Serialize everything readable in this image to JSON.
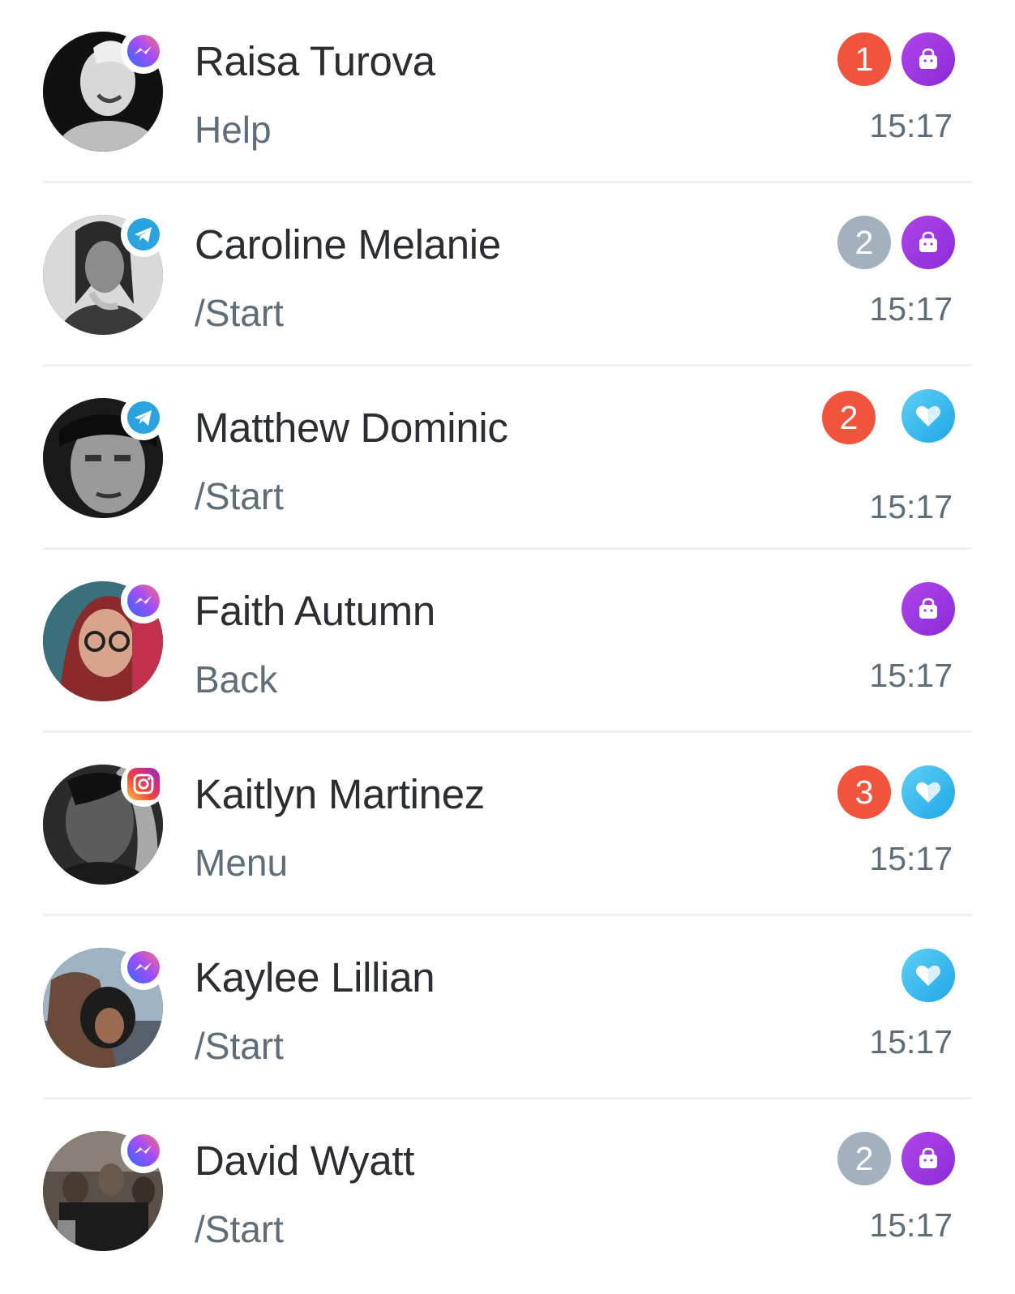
{
  "colors": {
    "unread_badge": "#f1543d",
    "read_badge": "#a2b1bd",
    "shop_tag": "#9b38e0",
    "heart_tag": "#3dbcef",
    "name_text": "#2a2d31",
    "secondary_text": "#5e6d78",
    "divider": "#eef1f3"
  },
  "chats": [
    {
      "name": "Raisa Turova",
      "preview": "Help",
      "time": "15:17",
      "channel_icon": "messenger-icon",
      "badge": "1",
      "badge_style": "unread",
      "tag_icon": "shopping-bag-icon"
    },
    {
      "name": "Caroline Melanie",
      "preview": "/Start",
      "time": "15:17",
      "channel_icon": "telegram-icon",
      "badge": "2",
      "badge_style": "read",
      "tag_icon": "shopping-bag-icon"
    },
    {
      "name": "Matthew Dominic",
      "preview": "/Start",
      "time": "15:17",
      "channel_icon": "telegram-icon",
      "badge": "2",
      "badge_style": "unread",
      "tag_icon": "heart-icon"
    },
    {
      "name": "Faith Autumn",
      "preview": "Back",
      "time": "15:17",
      "channel_icon": "messenger-icon",
      "badge": "",
      "badge_style": "none",
      "tag_icon": "shopping-bag-icon"
    },
    {
      "name": "Kaitlyn Martinez",
      "preview": "Menu",
      "time": "15:17",
      "channel_icon": "instagram-icon",
      "badge": "3",
      "badge_style": "unread",
      "tag_icon": "heart-icon"
    },
    {
      "name": "Kaylee Lillian",
      "preview": "/Start",
      "time": "15:17",
      "channel_icon": "messenger-icon",
      "badge": "",
      "badge_style": "none",
      "tag_icon": "heart-icon"
    },
    {
      "name": "David Wyatt",
      "preview": "/Start",
      "time": "15:17",
      "channel_icon": "messenger-icon",
      "badge": "2",
      "badge_style": "read",
      "tag_icon": "shopping-bag-icon"
    }
  ]
}
